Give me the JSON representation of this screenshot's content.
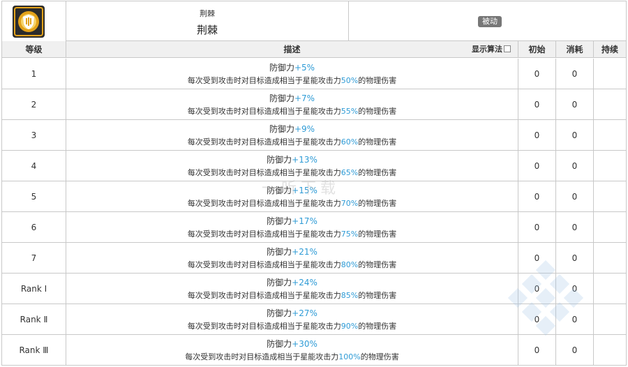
{
  "skill": {
    "name_small": "荆棘",
    "name_large": "荆棘",
    "type_badge": "被动",
    "icon": "shield-skill-icon"
  },
  "table": {
    "headers": {
      "level": "等级",
      "desc": "描述",
      "algo": "显示算法",
      "init": "初始",
      "cost": "消耗",
      "dur": "持续"
    },
    "rows": [
      {
        "level": "1",
        "def_label": "防御力",
        "def_value": "+5%",
        "effect_pre": "每次受到攻击时对目标造成相当于星能攻击力",
        "effect_value": "50%",
        "effect_post": "的物理伤害",
        "init": "0",
        "cost": "0"
      },
      {
        "level": "2",
        "def_label": "防御力",
        "def_value": "+7%",
        "effect_pre": "每次受到攻击时对目标造成相当于星能攻击力",
        "effect_value": "55%",
        "effect_post": "的物理伤害",
        "init": "0",
        "cost": "0"
      },
      {
        "level": "3",
        "def_label": "防御力",
        "def_value": "+9%",
        "effect_pre": "每次受到攻击时对目标造成相当于星能攻击力",
        "effect_value": "60%",
        "effect_post": "的物理伤害",
        "init": "0",
        "cost": "0"
      },
      {
        "level": "4",
        "def_label": "防御力",
        "def_value": "+13%",
        "effect_pre": "每次受到攻击时对目标造成相当于星能攻击力",
        "effect_value": "65%",
        "effect_post": "的物理伤害",
        "init": "0",
        "cost": "0"
      },
      {
        "level": "5",
        "def_label": "防御力",
        "def_value": "+15%",
        "effect_pre": "每次受到攻击时对目标造成相当于星能攻击力",
        "effect_value": "70%",
        "effect_post": "的物理伤害",
        "init": "0",
        "cost": "0"
      },
      {
        "level": "6",
        "def_label": "防御力",
        "def_value": "+17%",
        "effect_pre": "每次受到攻击时对目标造成相当于星能攻击力",
        "effect_value": "75%",
        "effect_post": "的物理伤害",
        "init": "0",
        "cost": "0"
      },
      {
        "level": "7",
        "def_label": "防御力",
        "def_value": "+21%",
        "effect_pre": "每次受到攻击时对目标造成相当于星能攻击力",
        "effect_value": "80%",
        "effect_post": "的物理伤害",
        "init": "0",
        "cost": "0"
      },
      {
        "level": "Rank Ⅰ",
        "def_label": "防御力",
        "def_value": "+24%",
        "effect_pre": "每次受到攻击时对目标造成相当于星能攻击力",
        "effect_value": "85%",
        "effect_post": "的物理伤害",
        "init": "0",
        "cost": "0"
      },
      {
        "level": "Rank Ⅱ",
        "def_label": "防御力",
        "def_value": "+27%",
        "effect_pre": "每次受到攻击时对目标造成相当于星能攻击力",
        "effect_value": "90%",
        "effect_post": "的物理伤害",
        "init": "0",
        "cost": "0"
      },
      {
        "level": "Rank Ⅲ",
        "def_label": "防御力",
        "def_value": "+30%",
        "effect_pre": "每次受到攻击时对目标造成相当于星能攻击力",
        "effect_value": "100%",
        "effect_post": "的物理伤害",
        "init": "0",
        "cost": "0"
      }
    ]
  },
  "watermark": "一听下载",
  "colors": {
    "highlight": "#2e9bd6",
    "header_bg": "#f0f0f0",
    "border": "#c8c8c8",
    "badge_bg": "#777777",
    "icon_gold": "#e3a21a"
  }
}
